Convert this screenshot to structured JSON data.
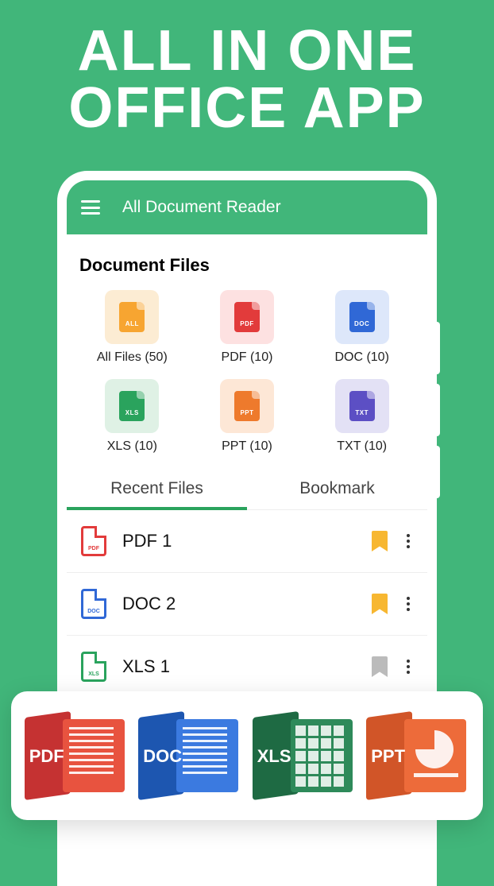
{
  "hero": {
    "line1": "ALL IN ONE",
    "line2": "OFFICE APP"
  },
  "app": {
    "title": "All Document Reader",
    "section_title": "Document Files"
  },
  "categories": [
    {
      "label": "All Files (50)",
      "tag": "ALL"
    },
    {
      "label": "PDF (10)",
      "tag": "PDF"
    },
    {
      "label": "DOC (10)",
      "tag": "DOC"
    },
    {
      "label": "XLS (10)",
      "tag": "XLS"
    },
    {
      "label": "PPT (10)",
      "tag": "PPT"
    },
    {
      "label": "TXT (10)",
      "tag": "TXT"
    }
  ],
  "tabs": {
    "recent": "Recent Files",
    "bookmark": "Bookmark"
  },
  "files": [
    {
      "name": "PDF 1",
      "type": "PDF",
      "bookmarked": true
    },
    {
      "name": "DOC 2",
      "type": "DOC",
      "bookmarked": true
    },
    {
      "name": "XLS 1",
      "type": "XLS",
      "bookmarked": false
    }
  ],
  "formats": {
    "pdf": "PDF",
    "doc": "DOC",
    "xls": "XLS",
    "ppt": "PPT"
  }
}
